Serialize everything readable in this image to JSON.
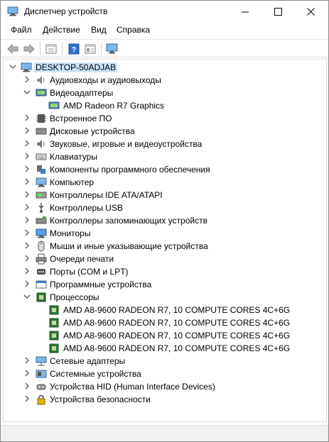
{
  "window": {
    "title": "Диспетчер устройств"
  },
  "menu": [
    {
      "label": "Файл"
    },
    {
      "label": "Действие"
    },
    {
      "label": "Вид"
    },
    {
      "label": "Справка"
    }
  ],
  "toolbar": [
    "back-icon",
    "forward-icon",
    "properties-icon",
    "help-icon",
    "view-icon",
    "monitor-icon"
  ],
  "tree": {
    "root": "DESKTOP-50ADJAB",
    "categories": [
      {
        "label": "Аудиовходы и аудиовыходы",
        "icon": "speaker-icon",
        "expanded": false
      },
      {
        "label": "Видеоадаптеры",
        "icon": "display-adapter-icon",
        "expanded": true,
        "children": [
          "AMD Radeon R7 Graphics"
        ]
      },
      {
        "label": "Встроенное ПО",
        "icon": "firmware-icon",
        "expanded": false
      },
      {
        "label": "Дисковые устройства",
        "icon": "disk-icon",
        "expanded": false
      },
      {
        "label": "Звуковые, игровые и видеоустройства",
        "icon": "sound-icon",
        "expanded": false
      },
      {
        "label": "Клавиатуры",
        "icon": "keyboard-icon",
        "expanded": false
      },
      {
        "label": "Компоненты программного обеспечения",
        "icon": "software-component-icon",
        "expanded": false
      },
      {
        "label": "Компьютер",
        "icon": "computer-icon",
        "expanded": false
      },
      {
        "label": "Контроллеры IDE ATA/ATAPI",
        "icon": "ide-icon",
        "expanded": false
      },
      {
        "label": "Контроллеры USB",
        "icon": "usb-icon",
        "expanded": false
      },
      {
        "label": "Контроллеры запоминающих устройств",
        "icon": "storage-controller-icon",
        "expanded": false
      },
      {
        "label": "Мониторы",
        "icon": "monitor-icon",
        "expanded": false
      },
      {
        "label": "Мыши и иные указывающие устройства",
        "icon": "mouse-icon",
        "expanded": false
      },
      {
        "label": "Очереди печати",
        "icon": "printer-icon",
        "expanded": false
      },
      {
        "label": "Порты (COM и LPT)",
        "icon": "port-icon",
        "expanded": false
      },
      {
        "label": "Программные устройства",
        "icon": "software-device-icon",
        "expanded": false
      },
      {
        "label": "Процессоры",
        "icon": "processor-icon",
        "expanded": true,
        "children": [
          "AMD A8-9600 RADEON R7, 10 COMPUTE CORES 4C+6G",
          "AMD A8-9600 RADEON R7, 10 COMPUTE CORES 4C+6G",
          "AMD A8-9600 RADEON R7, 10 COMPUTE CORES 4C+6G",
          "AMD A8-9600 RADEON R7, 10 COMPUTE CORES 4C+6G"
        ]
      },
      {
        "label": "Сетевые адаптеры",
        "icon": "network-icon",
        "expanded": false
      },
      {
        "label": "Системные устройства",
        "icon": "system-icon",
        "expanded": false
      },
      {
        "label": "Устройства HID (Human Interface Devices)",
        "icon": "hid-icon",
        "expanded": false
      },
      {
        "label": "Устройства безопасности",
        "icon": "security-icon",
        "expanded": false
      }
    ]
  },
  "colors": {
    "selection": "#cce4f7",
    "accent": "#0078d7"
  }
}
